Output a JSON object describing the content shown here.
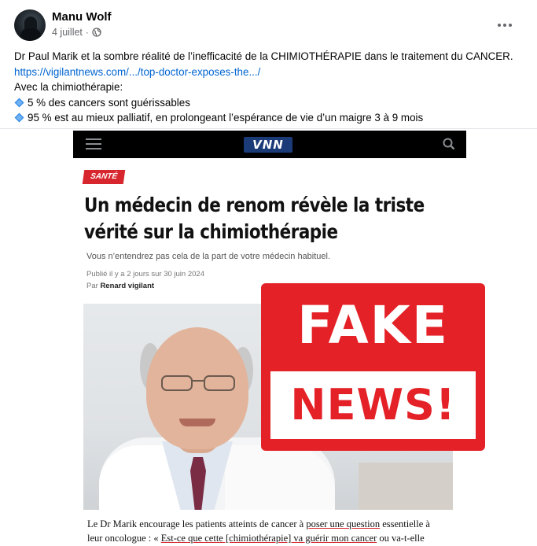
{
  "post": {
    "author": "Manu Wolf",
    "date": "4 juillet",
    "separator": "·",
    "privacy_icon": "globe-icon",
    "more_icon": "more-options-icon",
    "text_line1": "Dr Paul Marik et la sombre réalité de l’inefficacité de la CHIMIOTHÉRAPIE dans le traitement du CANCER.",
    "link": "https://vigilantnews.com/.../top-doctor-exposes-the.../",
    "text_line3": "Avec la chimiothérapie:",
    "bullet_icon": "blue-diamond-icon",
    "bullet1": "5 % des cancers sont guérissables",
    "bullet2": "95 % est au mieux palliatif, en prolongeant l’espérance de vie d’un maigre 3 à 9 mois"
  },
  "article": {
    "logo": "VNN",
    "category": "SANTÉ",
    "headline_line1": "Un médecin de renom révèle la triste",
    "headline_line2": "vérité sur la chimiothérapie",
    "subtitle": "Vous n’entendrez pas cela de la part de votre médecin habituel.",
    "published": "Publié il y a 2 jours sur 30 juin 2024",
    "by_prefix": "Par",
    "author": "Renard vigilant",
    "body_line1_a": "Le Dr Marik encourage les patients atteints de cancer à ",
    "body_line1_link": "poser une question",
    "body_line1_b": " essentielle à",
    "body_line2_a": "leur oncologue : « ",
    "body_line2_link": "Est-ce que cette [chimiothérapie] va guérir mon cancer",
    "body_line2_b": " ou va-t-elle"
  },
  "overlay": {
    "word1": "FAKE",
    "word2": "NEWS!",
    "color": "#e42127"
  },
  "colors": {
    "link": "#0064d1",
    "meta": "#65676b",
    "vnn_red": "#d8262e"
  }
}
